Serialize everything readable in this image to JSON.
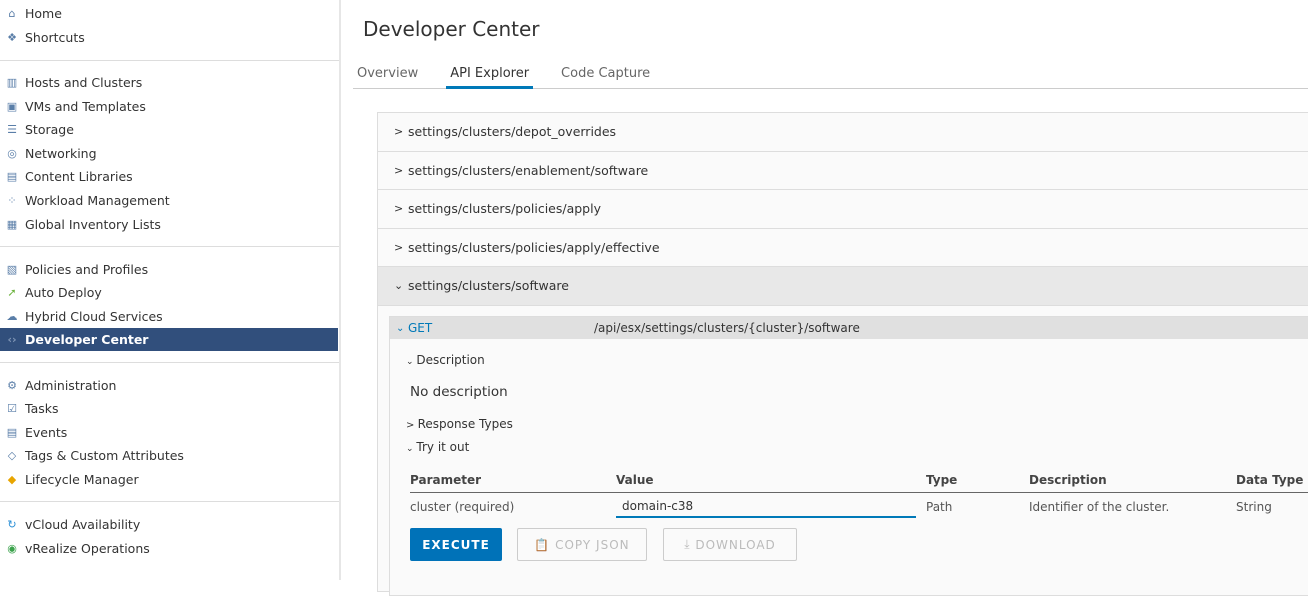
{
  "sidebar": {
    "items": [
      {
        "label": "Home",
        "icon": "home-icon"
      },
      {
        "label": "Shortcuts",
        "icon": "shortcuts-icon"
      },
      {
        "label": "Hosts and Clusters",
        "icon": "hosts-icon"
      },
      {
        "label": "VMs and Templates",
        "icon": "vm-icon"
      },
      {
        "label": "Storage",
        "icon": "storage-icon"
      },
      {
        "label": "Networking",
        "icon": "network-icon"
      },
      {
        "label": "Content Libraries",
        "icon": "library-icon"
      },
      {
        "label": "Workload Management",
        "icon": "workload-icon"
      },
      {
        "label": "Global Inventory Lists",
        "icon": "inventory-icon"
      },
      {
        "label": "Policies and Profiles",
        "icon": "policies-icon"
      },
      {
        "label": "Auto Deploy",
        "icon": "auto-deploy-icon"
      },
      {
        "label": "Hybrid Cloud Services",
        "icon": "cloud-icon"
      },
      {
        "label": "Developer Center",
        "icon": "code-icon",
        "active": true
      },
      {
        "label": "Administration",
        "icon": "admin-icon"
      },
      {
        "label": "Tasks",
        "icon": "tasks-icon"
      },
      {
        "label": "Events",
        "icon": "events-icon"
      },
      {
        "label": "Tags & Custom Attributes",
        "icon": "tag-icon"
      },
      {
        "label": "Lifecycle Manager",
        "icon": "lifecycle-icon"
      },
      {
        "label": "vCloud Availability",
        "icon": "vcloud-icon"
      },
      {
        "label": "vRealize Operations",
        "icon": "vrealize-icon"
      }
    ]
  },
  "main": {
    "title": "Developer Center",
    "tabs": [
      {
        "label": "Overview"
      },
      {
        "label": "API Explorer",
        "active": true
      },
      {
        "label": "Code Capture"
      }
    ],
    "endpoints": [
      "settings/clusters/depot_overrides",
      "settings/clusters/enablement/software",
      "settings/clusters/policies/apply",
      "settings/clusters/policies/apply/effective",
      "settings/clusters/software"
    ],
    "operation": {
      "method": "GET",
      "path": "/api/esx/settings/clusters/{cluster}/software",
      "description_label": "Description",
      "description": "No description",
      "response_types_label": "Response Types",
      "try_label": "Try it out",
      "columns": [
        "Parameter",
        "Value",
        "Type",
        "Description",
        "Data Type"
      ],
      "param": {
        "name": "cluster (required)",
        "value": "domain-c38",
        "type": "Path",
        "description": "Identifier of the cluster.",
        "data_type": "String"
      },
      "execute": "EXECUTE",
      "copy_json": "COPY JSON",
      "download": "DOWNLOAD"
    },
    "accent": "#0079b8"
  }
}
